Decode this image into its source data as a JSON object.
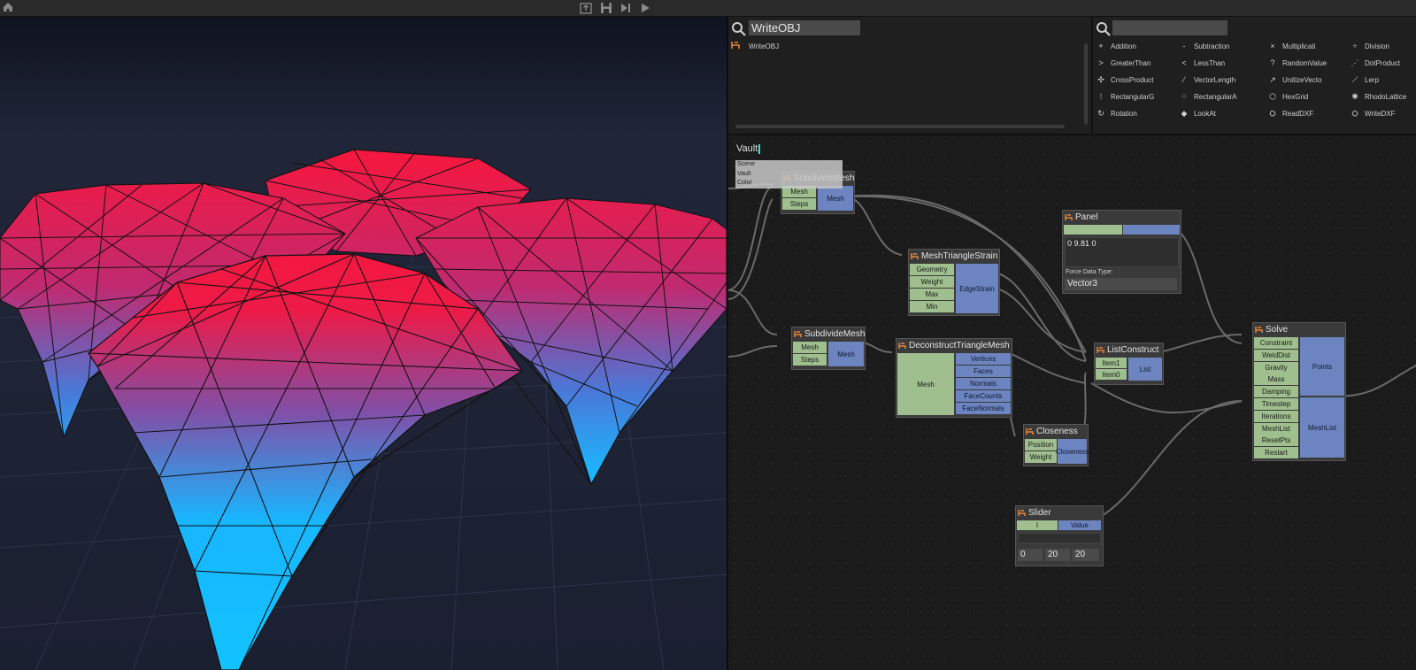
{
  "toolbar": {
    "icons": [
      "home-icon",
      "export-icon",
      "save-icon",
      "step-icon",
      "play-icon"
    ]
  },
  "search_left": {
    "query": "WriteOBJ",
    "results": [
      "WriteOBJ"
    ]
  },
  "search_right": {
    "query": "",
    "library": [
      {
        "label": "Addition",
        "glyph": "+"
      },
      {
        "label": "Subtraction",
        "glyph": "-"
      },
      {
        "label": "Multiplicati",
        "glyph": "×"
      },
      {
        "label": "Division",
        "glyph": "÷"
      },
      {
        "label": "GreaterThan",
        "glyph": ">"
      },
      {
        "label": "LessThan",
        "glyph": "<"
      },
      {
        "label": "RandomValue",
        "glyph": "?"
      },
      {
        "label": "DotProduct",
        "glyph": "⋰"
      },
      {
        "label": "CrossProduct",
        "glyph": "✣"
      },
      {
        "label": "VectorLength",
        "glyph": "⁄"
      },
      {
        "label": "UnitizeVecto",
        "glyph": "↗"
      },
      {
        "label": "Lerp",
        "glyph": "⟋"
      },
      {
        "label": "RectangularG",
        "glyph": "⁞"
      },
      {
        "label": "RectangularA",
        "glyph": "⁘"
      },
      {
        "label": "HexGrid",
        "glyph": "⬡"
      },
      {
        "label": "RhodoLattice",
        "glyph": "✺"
      },
      {
        "label": "Rotation",
        "glyph": "↻"
      },
      {
        "label": "LookAt",
        "glyph": "◆"
      },
      {
        "label": "ReadDXF",
        "glyph": "⛭"
      },
      {
        "label": "WriteDXF",
        "glyph": "⛭"
      }
    ]
  },
  "graph": {
    "vault": {
      "title": "Vault",
      "menu": [
        "Scene",
        "Vault",
        "Color"
      ]
    },
    "nodes": {
      "subdivide1": {
        "title": "SubdivideMesh",
        "inputs": [
          "Mesh",
          "Steps"
        ],
        "output": "Mesh"
      },
      "subdivide2": {
        "title": "SubdivideMesh",
        "inputs": [
          "Mesh",
          "Steps"
        ],
        "output": "Mesh"
      },
      "strain": {
        "title": "MeshTriangleStrain",
        "inputs": [
          "Geometry",
          "Weight",
          "Max",
          "Min"
        ],
        "output": "EdgeStrain"
      },
      "deconstruct": {
        "title": "DeconstructTriangleMesh",
        "input": "Mesh",
        "outputs": [
          "Vertices",
          "Faces",
          "Normals",
          "FaceCounts",
          "FaceNormals"
        ]
      },
      "closeness": {
        "title": "Closeness",
        "inputs": [
          "Position",
          "Weight"
        ],
        "output": "Closeness"
      },
      "listconstruct": {
        "title": "ListConstruct",
        "inputs": [
          "Item1",
          "Item0"
        ],
        "output": "List"
      },
      "panel": {
        "title": "Panel",
        "value": "0 9.81 0",
        "force_label": "Force Data Type:",
        "force_type": "Vector3"
      },
      "slider": {
        "title": "Slider",
        "input": "I",
        "output": "Value",
        "min": "0",
        "value": "20",
        "max": "20"
      },
      "solve": {
        "title": "Solve",
        "inputs": [
          "Constraint List",
          "WeldDist",
          "Gravity",
          "Mass",
          "Damping",
          "Timestep",
          "Iterations",
          "MeshList",
          "ResetPts",
          "Restart"
        ],
        "outputs": [
          "Points",
          "MeshList"
        ]
      }
    }
  },
  "colors": {
    "input_port": "#9fbf8e",
    "output_port": "#6c84bf",
    "mesh_top": "#ff1436",
    "mesh_bottom": "#16b8ff"
  }
}
